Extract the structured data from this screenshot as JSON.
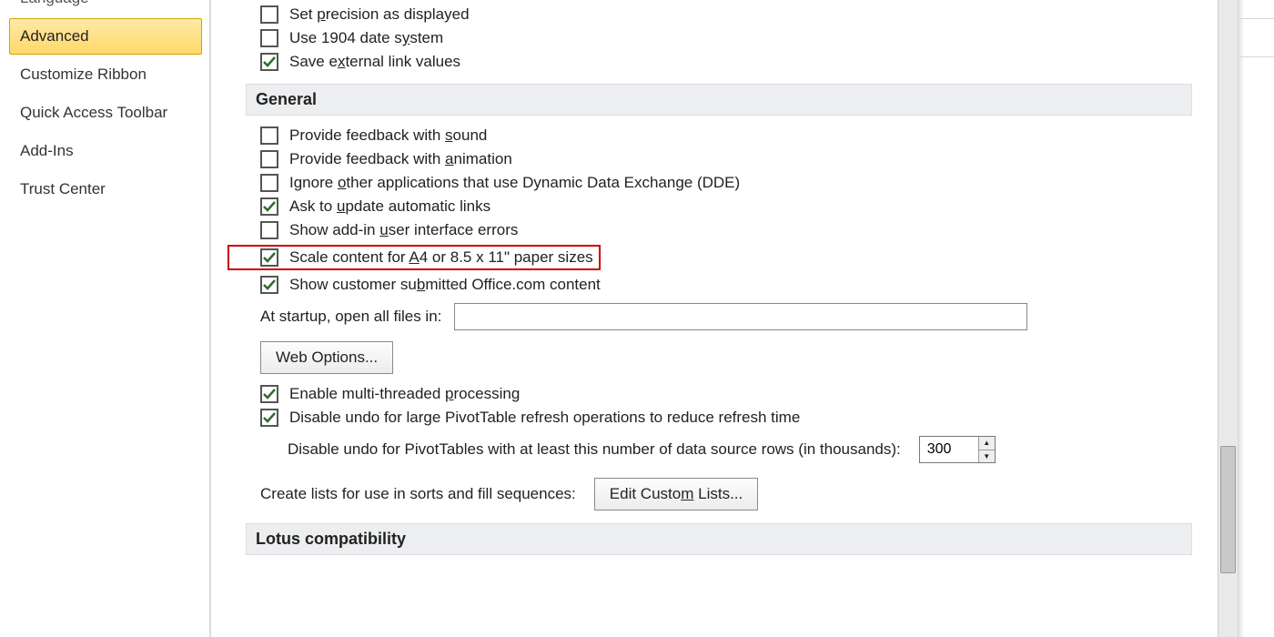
{
  "sidebar": {
    "items": [
      {
        "label": "Language",
        "state": "truncated"
      },
      {
        "label": "Advanced",
        "state": "selected"
      },
      {
        "label": "Customize Ribbon",
        "state": "normal"
      },
      {
        "label": "Quick Access Toolbar",
        "state": "normal"
      },
      {
        "label": "Add-Ins",
        "state": "normal"
      },
      {
        "label": "Trust Center",
        "state": "normal"
      }
    ]
  },
  "options_top": [
    {
      "id": "precision",
      "checked": false,
      "pre": "Set ",
      "u": "p",
      "post": "recision as displayed"
    },
    {
      "id": "date1904",
      "checked": false,
      "pre": "Use 1904 date s",
      "u": "y",
      "post": "stem"
    },
    {
      "id": "extlinks",
      "checked": true,
      "pre": "Save e",
      "u": "x",
      "post": "ternal link values"
    }
  ],
  "section_general": "General",
  "options_general": [
    {
      "id": "sound",
      "checked": false,
      "pre": "Provide feedback with ",
      "u": "s",
      "post": "ound"
    },
    {
      "id": "anim",
      "checked": false,
      "pre": "Provide feedback with ",
      "u": "a",
      "post": "nimation"
    },
    {
      "id": "dde",
      "checked": false,
      "pre": "Ignore ",
      "u": "o",
      "post": "ther applications that use Dynamic Data Exchange (DDE)"
    },
    {
      "id": "autolinks",
      "checked": true,
      "pre": "Ask to ",
      "u": "u",
      "post": "pdate automatic links"
    },
    {
      "id": "addinui",
      "checked": false,
      "pre": "Show add-in ",
      "u": "u",
      "post": "ser interface errors"
    },
    {
      "id": "scalea4",
      "checked": true,
      "highlight": true,
      "pre": "Scale content for ",
      "u": "A",
      "post": "4 or 8.5 x 11\" paper sizes"
    },
    {
      "id": "officecom",
      "checked": true,
      "pre": "Show customer su",
      "u": "b",
      "post": "mitted Office.com content"
    }
  ],
  "startup": {
    "label": "At startup, open all files in:",
    "value": ""
  },
  "web_options_btn": "Web Options...",
  "options_processing": [
    {
      "id": "multithread",
      "checked": true,
      "pre": "Enable multi-threaded ",
      "u": "p",
      "post": "rocessing"
    },
    {
      "id": "undopt",
      "checked": true,
      "pre": "",
      "u": "",
      "post": "Disable undo for large PivotTable refresh operations to reduce refresh time"
    }
  ],
  "undo_rows": {
    "label": "Disable undo for PivotTables with at least this number of data source rows (in thousands):",
    "value": "300"
  },
  "custom_lists": {
    "label": "Create lists for use in sorts and fill sequences:",
    "button": "Edit Custom Lists..."
  },
  "section_lotus": "Lotus compatibility"
}
